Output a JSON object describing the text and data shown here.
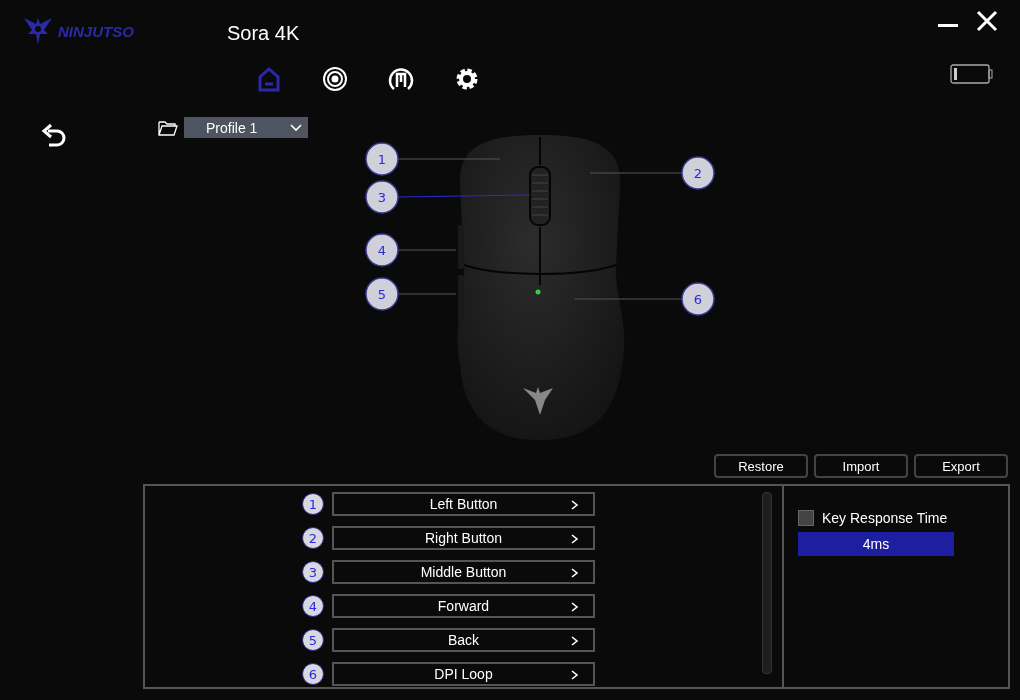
{
  "brand": "NINJUTSO",
  "title": "Sora 4K",
  "nav_tabs": [
    {
      "kind": "home",
      "selected": true
    },
    {
      "kind": "target",
      "selected": false
    },
    {
      "kind": "macro",
      "selected": false
    },
    {
      "kind": "settings",
      "selected": false
    }
  ],
  "profile": {
    "value": "Profile 1"
  },
  "callouts": [
    {
      "number": "1"
    },
    {
      "number": "2"
    },
    {
      "number": "3"
    },
    {
      "number": "4"
    },
    {
      "number": "5"
    },
    {
      "number": "6"
    }
  ],
  "actions": [
    "Restore",
    "Import",
    "Export"
  ],
  "buttons": [
    {
      "number": "1",
      "label": "Left Button"
    },
    {
      "number": "2",
      "label": "Right Button"
    },
    {
      "number": "3",
      "label": "Middle Button"
    },
    {
      "number": "4",
      "label": "Forward"
    },
    {
      "number": "5",
      "label": "Back"
    },
    {
      "number": "6",
      "label": "DPI Loop"
    }
  ],
  "key_response": {
    "label": "Key Response Time",
    "checked": false,
    "value": "4ms"
  }
}
